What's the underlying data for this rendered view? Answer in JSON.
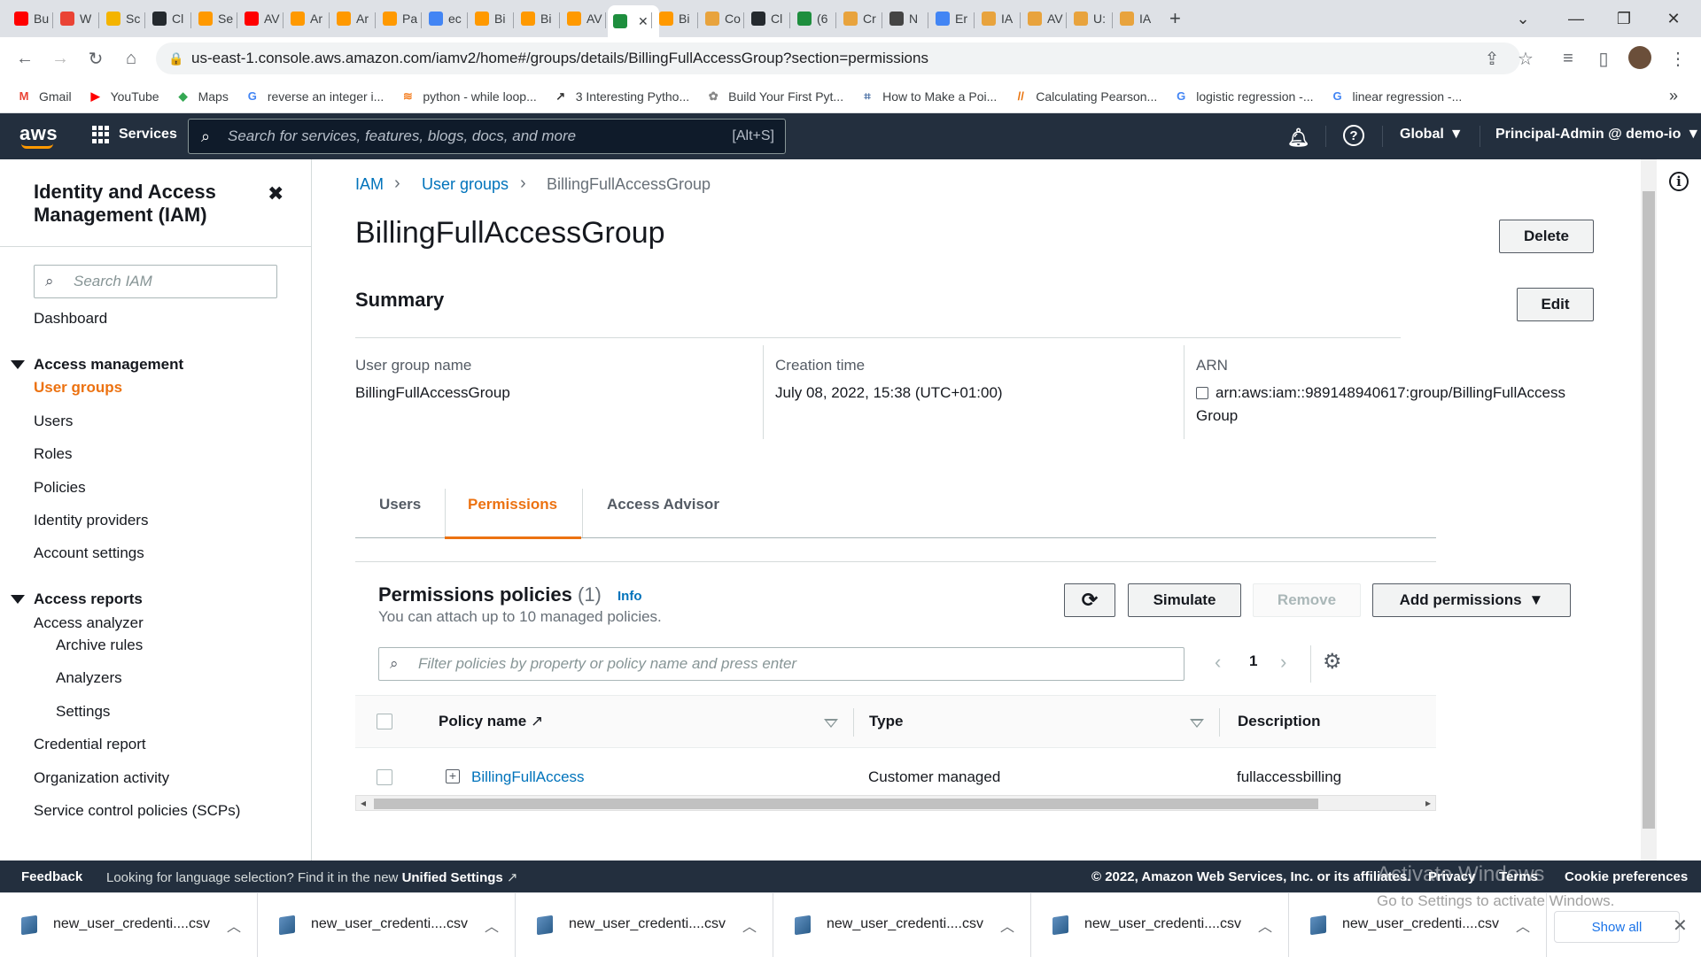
{
  "browser": {
    "tabs": [
      {
        "label": "Bu",
        "color": "#ff0000"
      },
      {
        "label": "W",
        "color": "#ea4335"
      },
      {
        "label": "Sc",
        "color": "#f4b400"
      },
      {
        "label": "Cl",
        "color": "#24292e"
      },
      {
        "label": "Se",
        "color": "#ff9900"
      },
      {
        "label": "AV",
        "color": "#ff0000"
      },
      {
        "label": "Ar",
        "color": "#ff9900"
      },
      {
        "label": "Ar",
        "color": "#ff9900"
      },
      {
        "label": "Pa",
        "color": "#ff9900"
      },
      {
        "label": "ec",
        "color": "#4285f4"
      },
      {
        "label": "Bi",
        "color": "#ff9900"
      },
      {
        "label": "Bi",
        "color": "#ff9900"
      },
      {
        "label": "AV",
        "color": "#ff9900"
      },
      {
        "label": "",
        "color": "#1e8e3e"
      },
      {
        "label": "Bi",
        "color": "#ff9900"
      },
      {
        "label": "Co",
        "color": "#e8a33d"
      },
      {
        "label": "Cl",
        "color": "#24292e"
      },
      {
        "label": "(6",
        "color": "#1e8e3e"
      },
      {
        "label": "Cr",
        "color": "#e8a33d"
      },
      {
        "label": "N",
        "color": "#444"
      },
      {
        "label": "Er",
        "color": "#4285f4"
      },
      {
        "label": "IA",
        "color": "#e8a33d"
      },
      {
        "label": "AV",
        "color": "#e8a33d"
      },
      {
        "label": "U:",
        "color": "#e8a33d"
      },
      {
        "label": "IA",
        "color": "#e8a33d"
      }
    ],
    "new_tab": "+",
    "url": "us-east-1.console.aws.amazon.com/iamv2/home#/groups/details/BillingFullAccessGroup?section=permissions",
    "bookmarks": [
      {
        "label": "Gmail",
        "icon": "M",
        "color": "#ea4335"
      },
      {
        "label": "YouTube",
        "icon": "▶",
        "color": "#ff0000"
      },
      {
        "label": "Maps",
        "icon": "◆",
        "color": "#34a853"
      },
      {
        "label": "reverse an integer i...",
        "icon": "G",
        "color": "#4285f4"
      },
      {
        "label": "python - while loop...",
        "icon": "≋",
        "color": "#f48024"
      },
      {
        "label": "3 Interesting Pytho...",
        "icon": "↗",
        "color": "#333"
      },
      {
        "label": "Build Your First Pyt...",
        "icon": "✿",
        "color": "#888"
      },
      {
        "label": "How to Make a Poi...",
        "icon": "⌗",
        "color": "#4a6fa5"
      },
      {
        "label": "Calculating Pearson...",
        "icon": "//",
        "color": "#e8710a"
      },
      {
        "label": "logistic regression -...",
        "icon": "G",
        "color": "#4285f4"
      },
      {
        "label": "linear regression -...",
        "icon": "G",
        "color": "#4285f4"
      }
    ],
    "more_bookmarks": "»"
  },
  "aws_header": {
    "logo": "aws",
    "services": "Services",
    "search_placeholder": "Search for services, features, blogs, docs, and more",
    "search_shortcut": "[Alt+S]",
    "region": "Global",
    "account": "Principal-Admin @ demo-io"
  },
  "sidebar": {
    "title": "Identity and Access Management (IAM)",
    "search_placeholder": "Search IAM",
    "dashboard": "Dashboard",
    "access_management": "Access management",
    "am_items": [
      "User groups",
      "Users",
      "Roles",
      "Policies",
      "Identity providers",
      "Account settings"
    ],
    "access_reports": "Access reports",
    "access_analyzer": "Access analyzer",
    "analyzer_items": [
      "Archive rules",
      "Analyzers",
      "Settings"
    ],
    "report_items": [
      "Credential report",
      "Organization activity",
      "Service control policies (SCPs)"
    ]
  },
  "breadcrumb": {
    "root": "IAM",
    "parent": "User groups",
    "current": "BillingFullAccessGroup"
  },
  "page": {
    "title": "BillingFullAccessGroup",
    "delete": "Delete",
    "summary": "Summary",
    "edit": "Edit",
    "group_name_label": "User group name",
    "group_name": "BillingFullAccessGroup",
    "creation_label": "Creation time",
    "creation_time": "July 08, 2022, 15:38 (UTC+01:00)",
    "arn_label": "ARN",
    "arn_line1": "arn:aws:iam::989148940617:group/BillingFullAccess",
    "arn_line2": "Group"
  },
  "tabs": [
    "Users",
    "Permissions",
    "Access Advisor"
  ],
  "permissions": {
    "title": "Permissions policies",
    "count": "(1)",
    "info": "Info",
    "subtitle": "You can attach up to 10 managed policies.",
    "simulate": "Simulate",
    "remove": "Remove",
    "add": "Add permissions",
    "filter_placeholder": "Filter policies by property or policy name and press enter",
    "page": "1",
    "columns": [
      "Policy name",
      "Type",
      "Description"
    ],
    "rows": [
      {
        "name": "BillingFullAccess",
        "type": "Customer managed",
        "description": "fullaccessbilling"
      }
    ]
  },
  "footer": {
    "feedback": "Feedback",
    "lang_text": "Looking for language selection? Find it in the new",
    "unified": "Unified Settings",
    "copyright": "© 2022, Amazon Web Services, Inc. or its affiliates.",
    "privacy": "Privacy",
    "terms": "Terms",
    "cookies": "Cookie preferences"
  },
  "watermark": {
    "line1": "Activate Windows",
    "line2": "Go to Settings to activate Windows."
  },
  "downloads": {
    "files": [
      "new_user_credenti....csv",
      "new_user_credenti....csv",
      "new_user_credenti....csv",
      "new_user_credenti....csv",
      "new_user_credenti....csv",
      "new_user_credenti....csv"
    ],
    "show_all": "Show all"
  },
  "colors": {
    "aws_dark": "#232f3e",
    "accent": "#ec7211",
    "link": "#0073bb"
  }
}
